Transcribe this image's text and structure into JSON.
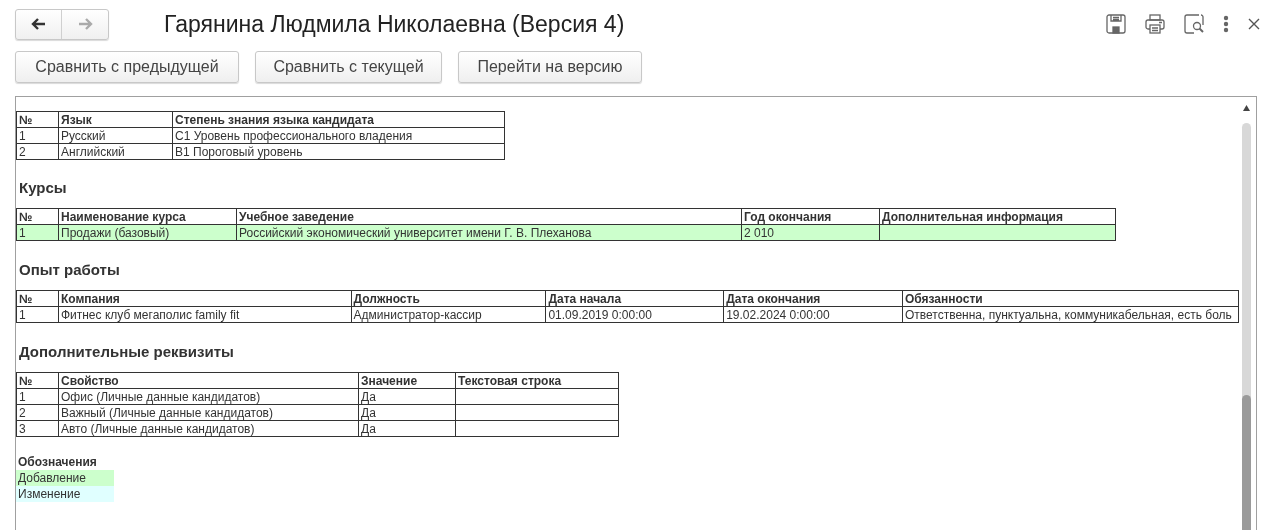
{
  "window": {
    "title": "Гарянина Людмила Николаевна (Версия 4)"
  },
  "nav": {
    "back_enabled": true,
    "forward_enabled": false
  },
  "toolbar": {
    "buttons": [
      "Сравнить с предыдущей",
      "Сравнить с текущей",
      "Перейти на версию"
    ]
  },
  "sections": [
    {
      "columns": [
        "№",
        "Язык",
        "Степень знания языка кандидата"
      ],
      "rows": [
        {
          "added": false,
          "cells": [
            "1",
            "Русский",
            "С1 Уровень профессионального владения"
          ]
        },
        {
          "added": false,
          "cells": [
            "2",
            "Английский",
            "В1 Пороговый уровень"
          ]
        }
      ]
    },
    {
      "heading": "Курсы",
      "columns": [
        "№",
        "Наименование курса",
        "Учебное заведение",
        "Год окончания",
        "Дополнительная информация"
      ],
      "rows": [
        {
          "added": true,
          "cells": [
            "1",
            "Продажи (базовый)",
            "Российский экономический университет имени Г. В. Плеханова",
            "2 010",
            ""
          ]
        }
      ]
    },
    {
      "heading": "Опыт работы",
      "columns": [
        "№",
        "Компания",
        "Должность",
        "Дата начала",
        "Дата окончания",
        "Обязанности"
      ],
      "rows": [
        {
          "added": false,
          "cells": [
            "1",
            "Фитнес клуб мегаполис family fit",
            "Администратор-кассир",
            "01.09.2019 0:00:00",
            "19.02.2024 0:00:00",
            "Ответственна, пунктуальна, коммуникабельная, есть боль"
          ]
        }
      ]
    },
    {
      "heading": "Дополнительные реквизиты",
      "columns": [
        "№",
        "Свойство",
        "Значение",
        "Текстовая строка"
      ],
      "rows": [
        {
          "added": false,
          "cells": [
            "1",
            "Офис (Личные данные кандидатов)",
            "Да",
            ""
          ]
        },
        {
          "added": false,
          "cells": [
            "2",
            "Важный (Личные данные кандидатов)",
            "Да",
            ""
          ]
        },
        {
          "added": false,
          "cells": [
            "3",
            "Авто (Личные данные кандидатов)",
            "Да",
            ""
          ]
        }
      ]
    }
  ],
  "legend": {
    "title": "Обозначения",
    "items": [
      {
        "label": "Добавление",
        "color": "#ccffcc"
      },
      {
        "label": "Изменение",
        "color": "#e0ffff"
      }
    ]
  }
}
